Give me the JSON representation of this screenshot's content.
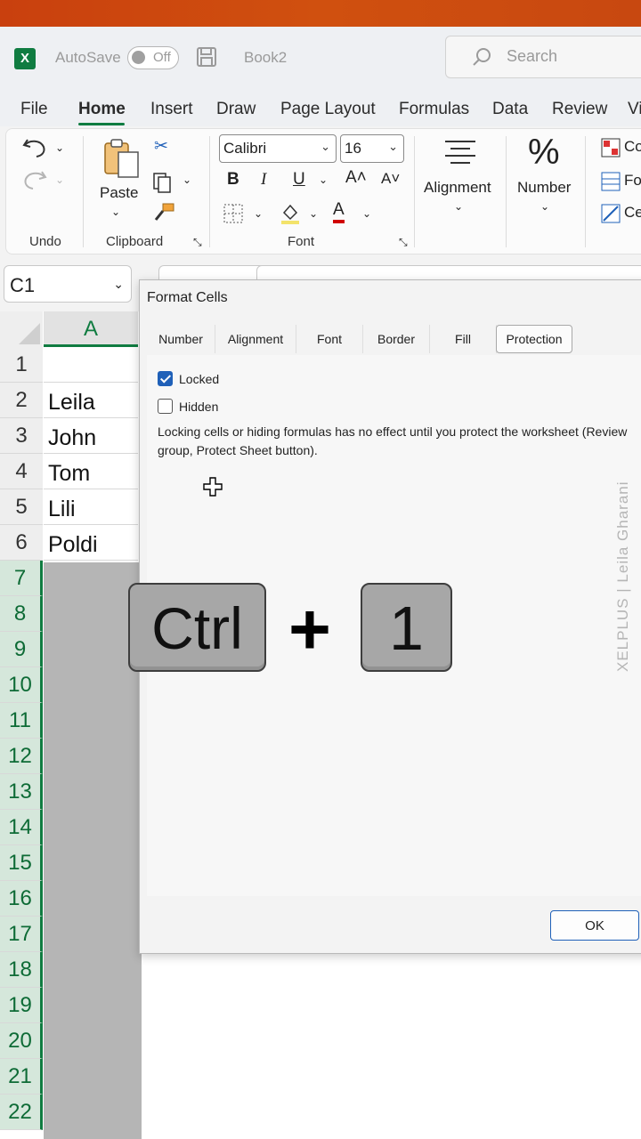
{
  "titlebar": {
    "autosave_label": "AutoSave",
    "autosave_state": "Off",
    "document_name": "Book2",
    "search_placeholder": "Search"
  },
  "menu": {
    "items": [
      "File",
      "Home",
      "Insert",
      "Draw",
      "Page Layout",
      "Formulas",
      "Data",
      "Review",
      "Vi"
    ],
    "active": "Home"
  },
  "ribbon": {
    "undo_group": "Undo",
    "clipboard_group": "Clipboard",
    "paste_label": "Paste",
    "font_group": "Font",
    "font_name": "Calibri",
    "font_size": "16",
    "bold": "B",
    "italic": "I",
    "underline": "U",
    "alignment_label": "Alignment",
    "number_label": "Number",
    "number_symbol": "%",
    "styles_cut": [
      "Co",
      "Fo",
      "Ce"
    ]
  },
  "namebox": {
    "value": "C1"
  },
  "sheet": {
    "column_header": "A",
    "rows": [
      "1",
      "2",
      "3",
      "4",
      "5",
      "6",
      "7",
      "8",
      "9",
      "10",
      "11",
      "12",
      "13",
      "14",
      "15",
      "16",
      "17",
      "18",
      "19",
      "20",
      "21",
      "22"
    ],
    "cells": [
      "",
      "Leila",
      "John",
      "Tom",
      "Lili",
      "Poldi"
    ]
  },
  "dialog": {
    "title": "Format Cells",
    "tabs": [
      "Number",
      "Alignment",
      "Font",
      "Border",
      "Fill",
      "Protection"
    ],
    "active_tab": "Protection",
    "locked_label": "Locked",
    "locked_checked": true,
    "hidden_label": "Hidden",
    "hidden_checked": false,
    "description": "Locking cells or hiding formulas has no effect until you protect the worksheet (Review group, Protect Sheet button).",
    "ok_label": "OK"
  },
  "shortcut": {
    "key1": "Ctrl",
    "plus": "+",
    "key2": "1"
  },
  "watermark": "XELPLUS | Leila Gharani",
  "colors": {
    "excel_green": "#107c41",
    "accent_blue": "#1f60b8",
    "title_orange": "#c9400e"
  }
}
